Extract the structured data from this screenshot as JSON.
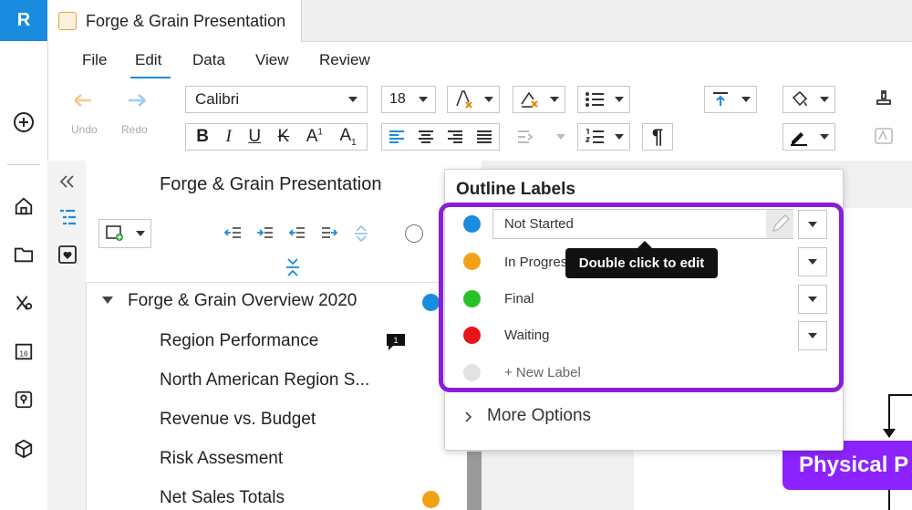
{
  "app": {
    "logo_letter": "R"
  },
  "tab": {
    "title": "Forge & Grain Presentation"
  },
  "menu": {
    "items": [
      "File",
      "Edit",
      "Data",
      "View",
      "Review"
    ],
    "active": "Edit"
  },
  "toolbar": {
    "undo_label": "Undo",
    "redo_label": "Redo",
    "font_family": "Calibri",
    "font_size": "18",
    "bold": "B",
    "italic": "I",
    "underline": "U",
    "strike": "K",
    "superscript": "A",
    "subscript": "A",
    "pilcrow": "¶"
  },
  "outline_panel": {
    "title": "Forge & Grain Presentation",
    "root": {
      "label": "Forge & Grain Overview 2020",
      "label_color": "#1a8ce0"
    },
    "items": [
      {
        "label": "Region Performance",
        "comment_count": "1"
      },
      {
        "label": "North American Region S..."
      },
      {
        "label": "Revenue vs. Budget"
      },
      {
        "label": "Risk Assesment"
      },
      {
        "label": "Net Sales Totals",
        "label_color": "#f2a116"
      }
    ]
  },
  "popup": {
    "title": "Outline Labels",
    "labels": [
      {
        "name": "Not Started",
        "color": "#1a8ce0"
      },
      {
        "name": "In Progress",
        "color": "#f2a116"
      },
      {
        "name": "Final",
        "color": "#27c227"
      },
      {
        "name": "Waiting",
        "color": "#e8141a"
      }
    ],
    "new_label": "+ New Label",
    "new_label_color": "#e3e3e3",
    "tooltip": "Double click to edit",
    "more_options": "More Options",
    "highlight_color": "#8a1ed8"
  },
  "canvas": {
    "node_label": "Physical P",
    "node_color": "#8b22ff"
  }
}
